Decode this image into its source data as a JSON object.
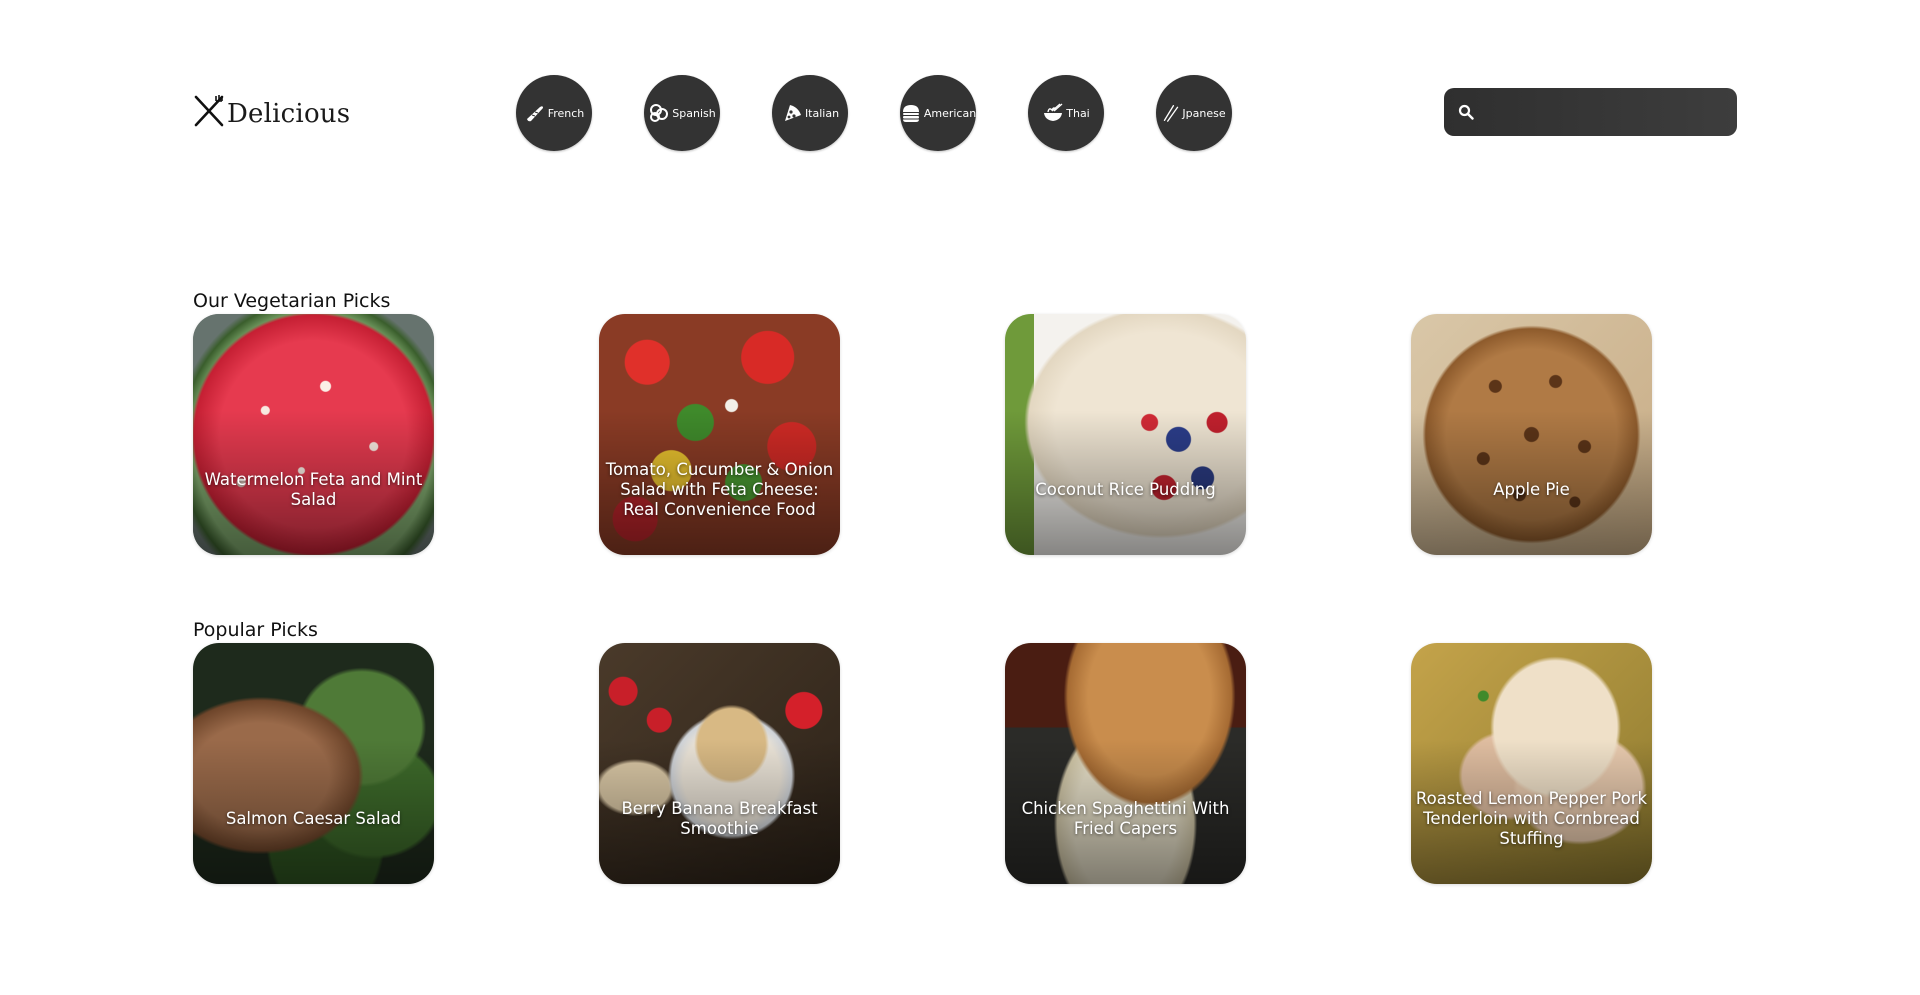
{
  "header": {
    "logo_text": "Delicious",
    "cuisines": [
      {
        "label": "French",
        "icon": "baguette-icon"
      },
      {
        "label": "Spanish",
        "icon": "paella-icon"
      },
      {
        "label": "Italian",
        "icon": "pizza-icon"
      },
      {
        "label": "American",
        "icon": "burger-icon"
      },
      {
        "label": "Thai",
        "icon": "noodle-bowl-icon"
      },
      {
        "label": "Jpanese",
        "icon": "chopsticks-icon"
      }
    ],
    "search": {
      "placeholder": "",
      "value": "",
      "icon": "search-icon"
    }
  },
  "sections": [
    {
      "title": "Our Vegetarian Picks",
      "cards": [
        {
          "title": "Watermelon Feta and Mint Salad"
        },
        {
          "title": "Tomato, Cucumber & Onion Salad with Feta Cheese: Real Convenience Food"
        },
        {
          "title": "Coconut Rice Pudding"
        },
        {
          "title": "Apple Pie"
        }
      ]
    },
    {
      "title": "Popular Picks",
      "cards": [
        {
          "title": "Salmon Caesar Salad"
        },
        {
          "title": "Berry Banana Breakfast Smoothie"
        },
        {
          "title": "Chicken Spaghettini With Fried Capers"
        },
        {
          "title": "Roasted Lemon Pepper Pork Tenderloin with Cornbread Stuffing"
        }
      ]
    }
  ],
  "colors": {
    "cuisine_button": "#333333",
    "search_bar": "#353535",
    "text": "#111111"
  }
}
